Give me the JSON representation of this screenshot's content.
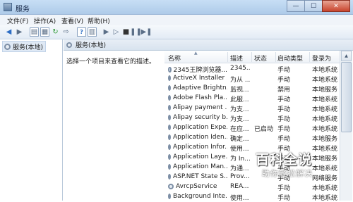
{
  "window": {
    "title": "服务"
  },
  "window_controls": {
    "minimize": "—",
    "maximize": "☐",
    "close": "✕"
  },
  "menu": [
    "文件(F)",
    "操作(A)",
    "查看(V)",
    "帮助(H)"
  ],
  "toolbar_icons": [
    "back-icon",
    "forward-icon",
    "console-tree-icon",
    "properties-icon",
    "refresh-icon",
    "export-icon",
    "help-icon",
    "show-pane-icon",
    "start-icon",
    "play-icon",
    "stop-icon",
    "pause-icon",
    "restart-icon"
  ],
  "tree": {
    "item_label": "服务(本地)"
  },
  "main_header": {
    "label": "服务(本地)"
  },
  "description_panel": {
    "text": "选择一个项目来查看它的描述。"
  },
  "table": {
    "columns": [
      "名称",
      "描述",
      "状态",
      "启动类型",
      "登录为"
    ],
    "rows": [
      {
        "name": "2345王牌浏览器...",
        "desc": "2345...",
        "status": "",
        "startup": "手动",
        "logon": "本地系统"
      },
      {
        "name": "ActiveX Installer ...",
        "desc": "为从 ...",
        "status": "",
        "startup": "手动",
        "logon": "本地系统"
      },
      {
        "name": "Adaptive Brightn...",
        "desc": "监视...",
        "status": "",
        "startup": "禁用",
        "logon": "本地服务"
      },
      {
        "name": "Adobe Flash Pla...",
        "desc": "此服...",
        "status": "",
        "startup": "手动",
        "logon": "本地系统"
      },
      {
        "name": "Alipay payment ...",
        "desc": "为支...",
        "status": "",
        "startup": "手动",
        "logon": "本地系统"
      },
      {
        "name": "Alipay security b...",
        "desc": "为支...",
        "status": "",
        "startup": "手动",
        "logon": "本地系统"
      },
      {
        "name": "Application Expe...",
        "desc": "在应...",
        "status": "已启动",
        "startup": "手动",
        "logon": "本地系统"
      },
      {
        "name": "Application Iden...",
        "desc": "确定...",
        "status": "",
        "startup": "手动",
        "logon": "本地服务"
      },
      {
        "name": "Application Infor...",
        "desc": "使用...",
        "status": "",
        "startup": "手动",
        "logon": "本地系统"
      },
      {
        "name": "Application Laye...",
        "desc": "为 In...",
        "status": "",
        "startup": "手动",
        "logon": "本地服务"
      },
      {
        "name": "Application Man...",
        "desc": "为通...",
        "status": "",
        "startup": "手动",
        "logon": "本地系统"
      },
      {
        "name": "ASP.NET State S...",
        "desc": "Prov...",
        "status": "",
        "startup": "手动",
        "logon": "网络服务"
      },
      {
        "name": "AvrcpService",
        "desc": "REA...",
        "status": "",
        "startup": "手动",
        "logon": "本地系统"
      },
      {
        "name": "Background Inte...",
        "desc": "使用...",
        "status": "",
        "startup": "手动",
        "logon": "本地系统"
      }
    ]
  },
  "watermark": {
    "logo": "百科全说",
    "sub": "助你轻松解决"
  },
  "colors": {
    "titlebar": "#aecbe9",
    "header": "#d8e3ef",
    "selection": "#dfe9f5"
  }
}
